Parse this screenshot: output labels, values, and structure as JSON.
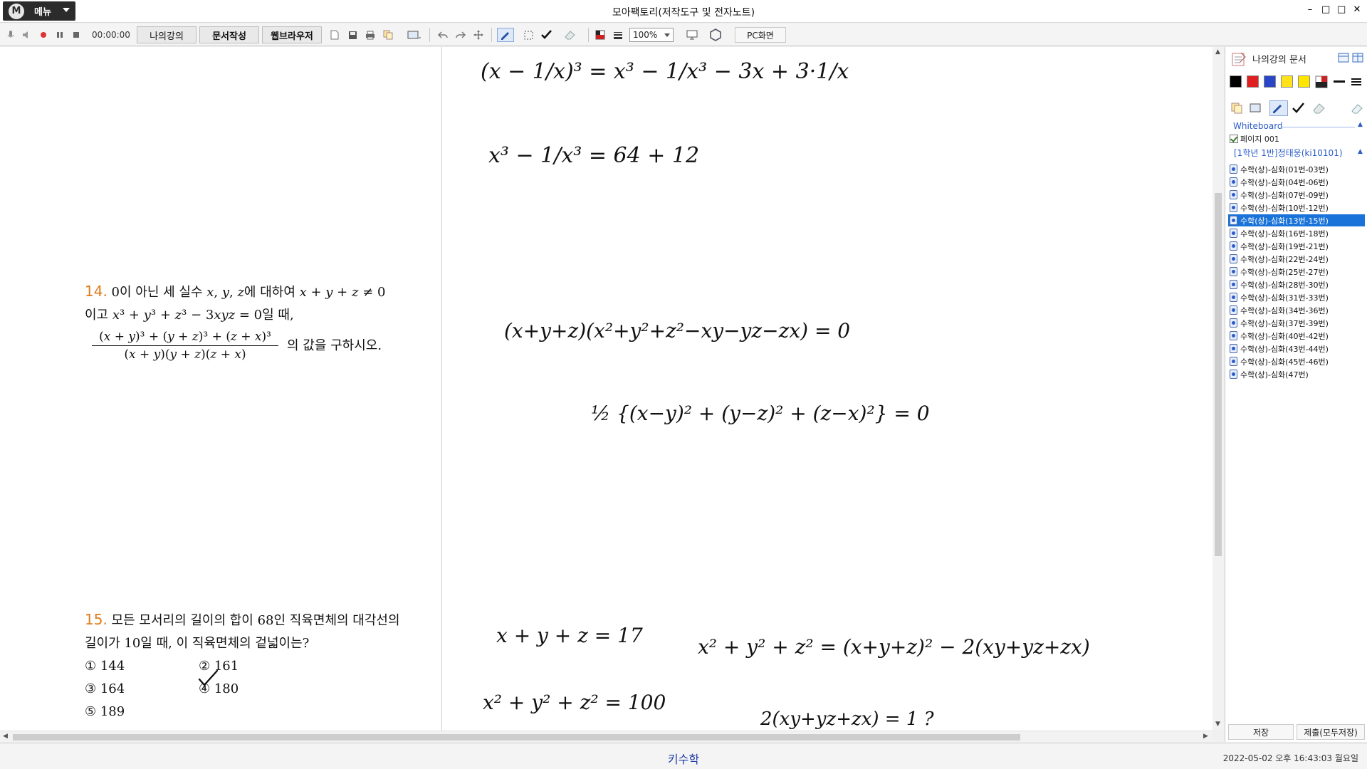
{
  "window": {
    "title": "모아팩토리(저작도구 및 전자노트)",
    "menu_label": "메뉴",
    "menu_logo": "M",
    "controls": [
      "–",
      "□",
      "□",
      "✕"
    ]
  },
  "toolbar": {
    "timer": "00:00:00",
    "tabs": [
      "나의강의",
      "문서작성",
      "웹브라우저"
    ],
    "zoom": "100%",
    "pc_button": "PC화면"
  },
  "problems": {
    "p14": {
      "number": "14.",
      "line1": "0이 아닌 세 실수 𝑥, 𝑦, 𝑧에 대하여 𝑥 + 𝑦 + 𝑧 ≠ 0",
      "line2": "이고 𝑥³ + 𝑦³ + 𝑧³ − 3𝑥𝑦𝑧 = 0일 때,",
      "numerator": "(𝑥 + 𝑦)³ + (𝑦 + 𝑧)³ + (𝑧 + 𝑥)³",
      "denominator": "(𝑥 + 𝑦)(𝑦 + 𝑧)(𝑧 + 𝑥)",
      "tail": "의 값을 구하시오."
    },
    "p15": {
      "number": "15.",
      "line1": "모든 모서리의 길이의 합이 68인 직육면체의 대각선의",
      "line2": "길이가 10일 때, 이 직육면체의 겉넓이는?",
      "choices": [
        "① 144",
        "② 161",
        "③ 164",
        "④ 180",
        "⑤ 189"
      ]
    }
  },
  "handwriting": {
    "l1": "(x − 1/x)³ = x³ − 1/x³ − 3x + 3·1/x",
    "l2": "x³ − 1/x³ = 64 + 12",
    "l3": "(x+y+z)(x²+y²+z²−xy−yz−zx) = 0",
    "l4": "½ {(x−y)² + (y−z)² + (z−x)²} = 0",
    "l5": "x + y + z = 17",
    "l6": "x² + y² + z² = (x+y+z)² − 2(xy+yz+zx)",
    "l7": "x² + y² + z² = 100",
    "l8": "2(xy+yz+zx) = 1 ?"
  },
  "sidebar": {
    "title": "나의강의 문서",
    "swatch_colors": [
      "#000000",
      "#e02020",
      "#2a46c8",
      "#ffe21a",
      "#ffe600"
    ],
    "whiteboard_label": "Whiteboard",
    "page_item": "페이지 001",
    "student": "[1학년 1반]정태웅(ki10101)",
    "documents": [
      "수학(상)-심화(01번-03번)",
      "수학(상)-심화(04번-06번)",
      "수학(상)-심화(07번-09번)",
      "수학(상)-심화(10번-12번)",
      "수학(상)-심화(13번-15번)",
      "수학(상)-심화(16번-18번)",
      "수학(상)-심화(19번-21번)",
      "수학(상)-심화(22번-24번)",
      "수학(상)-심화(25번-27번)",
      "수학(상)-심화(28번-30번)",
      "수학(상)-심화(31번-33번)",
      "수학(상)-심화(34번-36번)",
      "수학(상)-심화(37번-39번)",
      "수학(상)-심화(40번-42번)",
      "수학(상)-심화(43번-44번)",
      "수학(상)-심화(45번-46번)",
      "수학(상)-심화(47번)"
    ],
    "selected_document": "수학(상)-심화(13번-15번)",
    "save_button": "저장",
    "submit_button": "제출(모두저장)"
  },
  "statusbar": {
    "center": "키수학",
    "datetime": "2022-05-02 오후 16:43:03 월요일"
  }
}
